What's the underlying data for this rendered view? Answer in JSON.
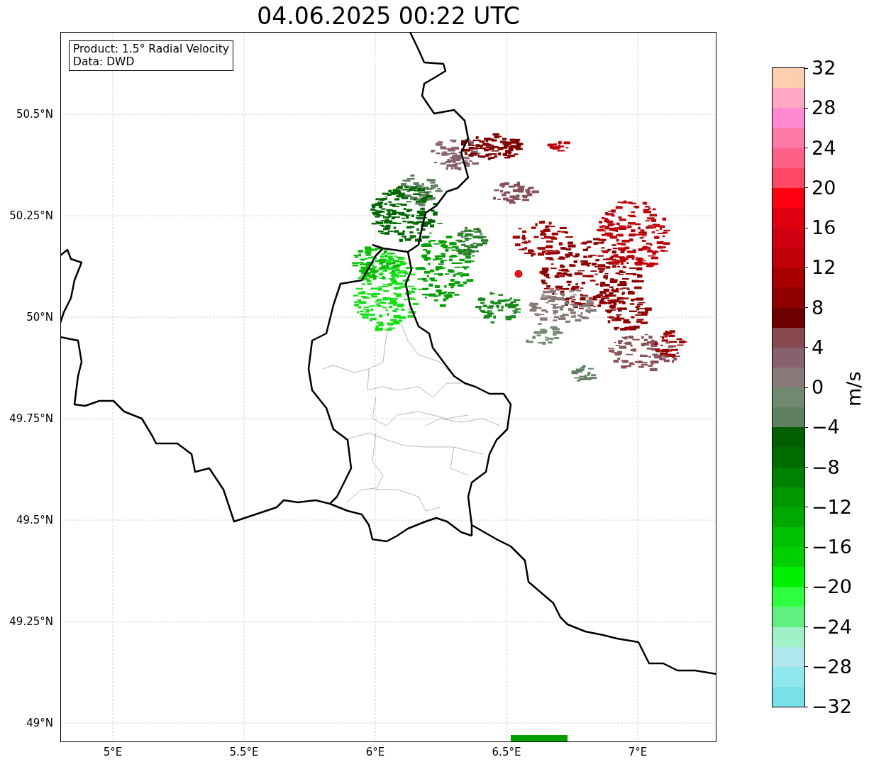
{
  "title": "04.06.2025 00:22 UTC",
  "map": {
    "info_box": [
      "Product: 1.5° Radial Velocity",
      "Data: DWD"
    ],
    "lat_labels": [
      "50.5°N",
      "50.25°N",
      "50°N",
      "49.75°N",
      "49.5°N",
      "49.25°N",
      "49°N"
    ],
    "lon_labels": [
      "5°E",
      "5.5°E",
      "6°E",
      "6.5°E",
      "7°E"
    ]
  },
  "colorbar": {
    "label": "m/s",
    "ticks": [
      "32",
      "28",
      "24",
      "20",
      "16",
      "12",
      "8",
      "4",
      "0",
      "−4",
      "−8",
      "−12",
      "−16",
      "−20",
      "−24",
      "−28",
      "−32"
    ],
    "segments": [
      {
        "color": "#ffcdb0"
      },
      {
        "color": "#ffa8c5"
      },
      {
        "color": "#ff88d0"
      },
      {
        "color": "#ff78a8"
      },
      {
        "color": "#ff6088"
      },
      {
        "color": "#ff4868"
      },
      {
        "color": "#ff0010"
      },
      {
        "color": "#e00010"
      },
      {
        "color": "#d00010"
      },
      {
        "color": "#c00008"
      },
      {
        "color": "#a80000"
      },
      {
        "color": "#900000"
      },
      {
        "color": "#700000"
      },
      {
        "color": "#884850"
      },
      {
        "color": "#886070"
      },
      {
        "color": "#887878"
      },
      {
        "color": "#6f8a6f"
      },
      {
        "color": "#5f8060"
      },
      {
        "color": "#006000"
      },
      {
        "color": "#006c00"
      },
      {
        "color": "#008000"
      },
      {
        "color": "#009800"
      },
      {
        "color": "#00a800"
      },
      {
        "color": "#00c000"
      },
      {
        "color": "#00d000"
      },
      {
        "color": "#00f000"
      },
      {
        "color": "#30ff40"
      },
      {
        "color": "#60f080"
      },
      {
        "color": "#a0f0c8"
      },
      {
        "color": "#b0e8ee"
      },
      {
        "color": "#90e8ee"
      },
      {
        "color": "#78e0e8"
      }
    ]
  }
}
